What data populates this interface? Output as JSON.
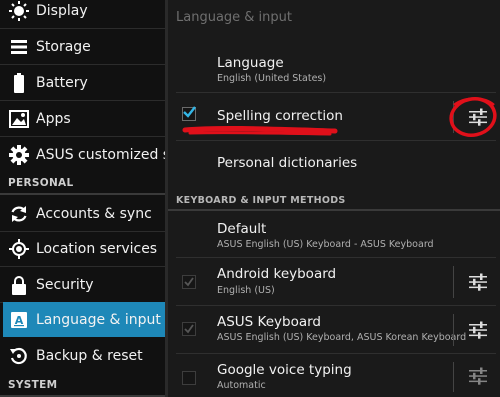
{
  "sidebar": {
    "items": [
      {
        "label": "Display",
        "icon": "display-icon"
      },
      {
        "label": "Storage",
        "icon": "storage-icon"
      },
      {
        "label": "Battery",
        "icon": "battery-icon"
      },
      {
        "label": "Apps",
        "icon": "apps-icon"
      },
      {
        "label": "ASUS customized settings",
        "icon": "gear-icon"
      }
    ],
    "personal_header": "PERSONAL",
    "personal_items": [
      {
        "label": "Accounts & sync",
        "icon": "sync-icon"
      },
      {
        "label": "Location services",
        "icon": "location-icon"
      },
      {
        "label": "Security",
        "icon": "lock-icon"
      },
      {
        "label": "Language & input",
        "icon": "keyboard-icon",
        "active": true
      },
      {
        "label": "Backup & reset",
        "icon": "backup-icon"
      }
    ],
    "system_header": "SYSTEM"
  },
  "panel": {
    "title": "Language & input",
    "language": {
      "title": "Language",
      "summary": "English (United States)"
    },
    "spelling": {
      "title": "Spelling correction",
      "checked": true
    },
    "dictionaries": {
      "title": "Personal dictionaries"
    },
    "category": "KEYBOARD & INPUT METHODS",
    "default": {
      "title": "Default",
      "summary": "ASUS English (US) Keyboard - ASUS Keyboard"
    },
    "android_kb": {
      "title": "Android keyboard",
      "summary": "English (US)",
      "checked": true
    },
    "asus_kb": {
      "title": "ASUS Keyboard",
      "summary": "ASUS English (US) Keyboard, ASUS Korean Keyboard",
      "checked": true
    },
    "google_voice": {
      "title": "Google voice typing",
      "summary": "Automatic",
      "checked": false
    }
  },
  "colors": {
    "accent": "#1e88b8",
    "annotation": "#e0101a"
  }
}
